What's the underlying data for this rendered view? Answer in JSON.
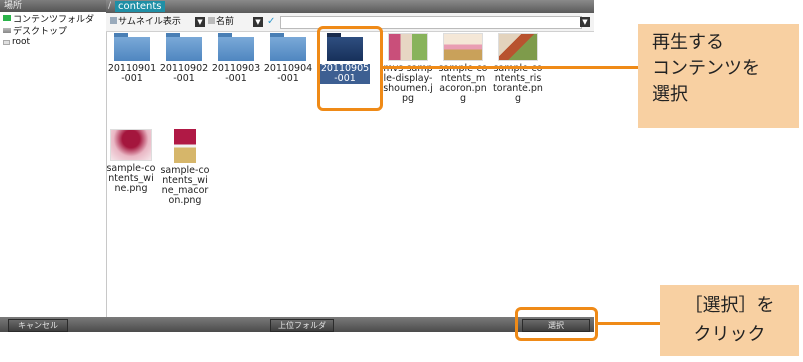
{
  "sidebar": {
    "header": "場所",
    "items": [
      {
        "label": "コンテンツフォルダ",
        "icon": "folder-green-icon"
      },
      {
        "label": "デスクトップ",
        "icon": "desktop-icon"
      },
      {
        "label": "root",
        "icon": "drive-icon"
      }
    ]
  },
  "path": {
    "separator": "/",
    "current": "contents"
  },
  "toolbar": {
    "view_mode": "サムネイル表示",
    "sort": "名前"
  },
  "files": [
    {
      "label": "20110901-001",
      "kind": "folder"
    },
    {
      "label": "20110902-001",
      "kind": "folder"
    },
    {
      "label": "20110903-001",
      "kind": "folder"
    },
    {
      "label": "20110904-001",
      "kind": "folder"
    },
    {
      "label": "20110905-001",
      "kind": "folder",
      "selected": true
    },
    {
      "label": "mvs-sample-display-shoumen.jpg",
      "kind": "image"
    },
    {
      "label": "sample-contents_macoron.png",
      "kind": "image"
    },
    {
      "label": "sample-contents_ristorante.png",
      "kind": "image"
    },
    {
      "label": "sample-contents_wine.png",
      "kind": "image"
    },
    {
      "label": "sample-contents_wine_macoron.png",
      "kind": "image"
    }
  ],
  "bottom_bar": {
    "cancel": "キャンセル",
    "parent": "上位フォルダ",
    "select": "選択"
  },
  "callouts": {
    "play": {
      "line1": "再生する",
      "line2": "コンテンツを",
      "line3": "選択"
    },
    "click": {
      "line1": "［選択］を",
      "line2": "クリック"
    }
  },
  "colors": {
    "accent": "#ef8a17",
    "callout_bg": "#f8d0a2",
    "selection": "#3d5f92"
  }
}
